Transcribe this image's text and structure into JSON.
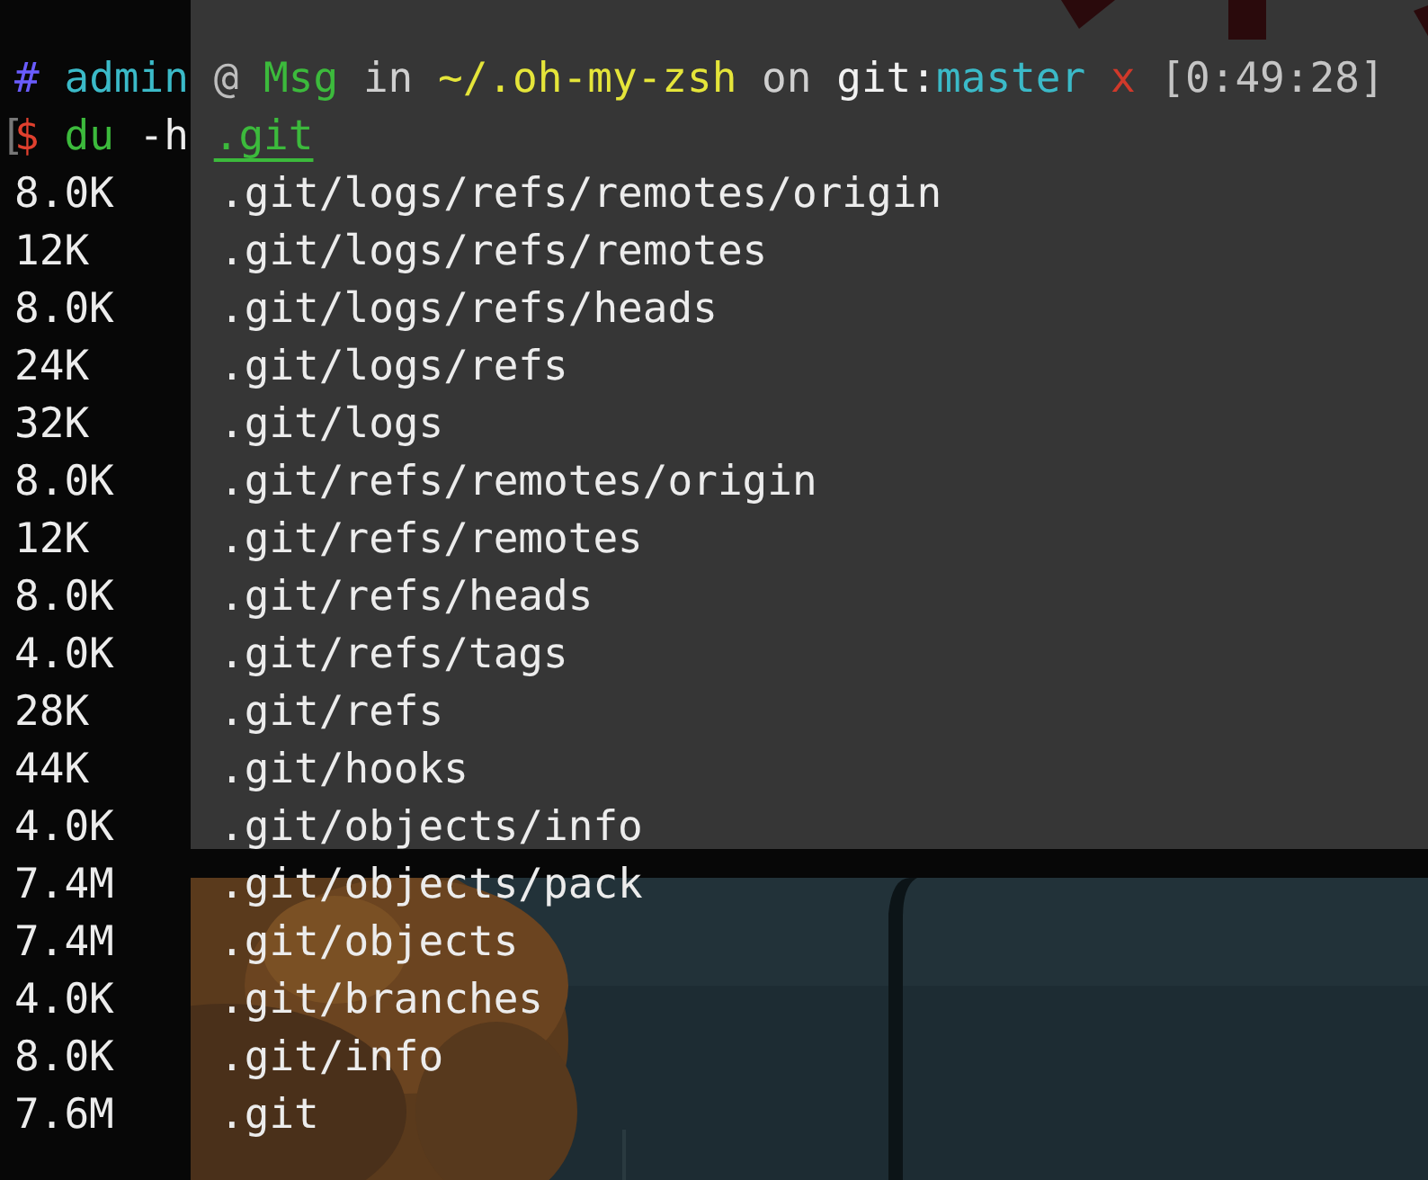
{
  "prompt": {
    "symbol": "#",
    "user": "admin",
    "at": "@",
    "host": "Msg",
    "in": "in",
    "path": "~/.oh-my-zsh",
    "on": "on",
    "vcs": "git:",
    "branch": "master",
    "dirty": "x",
    "time": "[0:49:28]"
  },
  "command": {
    "bracket": "[",
    "sigil": "$",
    "program": "du",
    "args": "-h",
    "target": ".git"
  },
  "rows": [
    {
      "size": "8.0K",
      "path": ".git/logs/refs/remotes/origin"
    },
    {
      "size": "12K",
      "path": ".git/logs/refs/remotes"
    },
    {
      "size": "8.0K",
      "path": ".git/logs/refs/heads"
    },
    {
      "size": "24K",
      "path": ".git/logs/refs"
    },
    {
      "size": "32K",
      "path": ".git/logs"
    },
    {
      "size": "8.0K",
      "path": ".git/refs/remotes/origin"
    },
    {
      "size": "12K",
      "path": ".git/refs/remotes"
    },
    {
      "size": "8.0K",
      "path": ".git/refs/heads"
    },
    {
      "size": "4.0K",
      "path": ".git/refs/tags"
    },
    {
      "size": "28K",
      "path": ".git/refs"
    },
    {
      "size": "44K",
      "path": ".git/hooks"
    },
    {
      "size": "4.0K",
      "path": ".git/objects/info"
    },
    {
      "size": "7.4M",
      "path": ".git/objects/pack"
    },
    {
      "size": "7.4M",
      "path": ".git/objects"
    },
    {
      "size": "4.0K",
      "path": ".git/branches"
    },
    {
      "size": "8.0K",
      "path": ".git/info"
    },
    {
      "size": "7.6M",
      "path": ".git"
    }
  ]
}
